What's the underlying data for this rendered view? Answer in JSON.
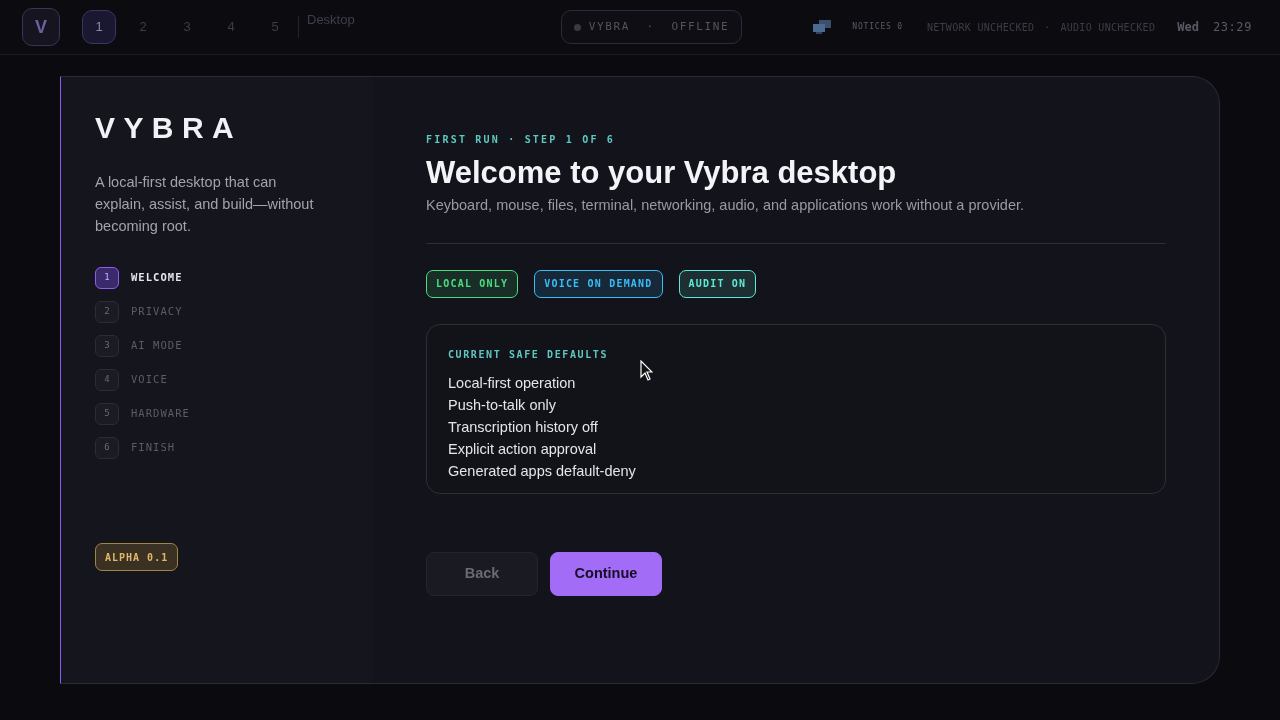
{
  "topbar": {
    "logo": "V",
    "workspaces": [
      {
        "label": "1",
        "selected": true
      },
      {
        "label": "2",
        "selected": false
      },
      {
        "label": "3",
        "selected": false
      },
      {
        "label": "4",
        "selected": false
      },
      {
        "label": "5",
        "selected": false
      }
    ],
    "window_title": "Desktop",
    "status_pill": {
      "name": "VYBRA",
      "separator": "·",
      "state": "OFFLINE"
    },
    "notices": "NOTICES 0",
    "network": "NETWORK UNCHECKED",
    "separator": "·",
    "audio": "AUDIO UNCHECKED",
    "day": "Wed",
    "time": "23:29"
  },
  "dialog": {
    "sidebar": {
      "brand": "VYBRA",
      "tagline": "A local-first desktop that can explain, assist, and build—without becoming root.",
      "steps": [
        {
          "number": "1",
          "label": "WELCOME",
          "selected": true
        },
        {
          "number": "2",
          "label": "PRIVACY",
          "selected": false
        },
        {
          "number": "3",
          "label": "AI MODE",
          "selected": false
        },
        {
          "number": "4",
          "label": "VOICE",
          "selected": false
        },
        {
          "number": "5",
          "label": "HARDWARE",
          "selected": false
        },
        {
          "number": "6",
          "label": "FINISH",
          "selected": false
        }
      ],
      "version": "ALPHA 0.1"
    },
    "eyebrow": "FIRST RUN · STEP 1 OF 6",
    "title": "Welcome to your Vybra desktop",
    "subtitle": "Keyboard, mouse, files, terminal, networking, audio, and applications work without a provider.",
    "tags": [
      {
        "label": "LOCAL ONLY",
        "color": "#4ade80"
      },
      {
        "label": "VOICE ON DEMAND",
        "color": "#38bdf8"
      },
      {
        "label": "AUDIT ON",
        "color": "#5eead4"
      }
    ],
    "defaults": {
      "heading": "CURRENT SAFE DEFAULTS",
      "items": [
        "Local-first operation",
        "Push-to-talk only",
        "Transcription history off",
        "Explicit action approval",
        "Generated apps default-deny"
      ]
    },
    "buttons": [
      {
        "label": "Back",
        "kind": "secondary"
      },
      {
        "label": "Continue",
        "kind": "primary"
      }
    ]
  }
}
